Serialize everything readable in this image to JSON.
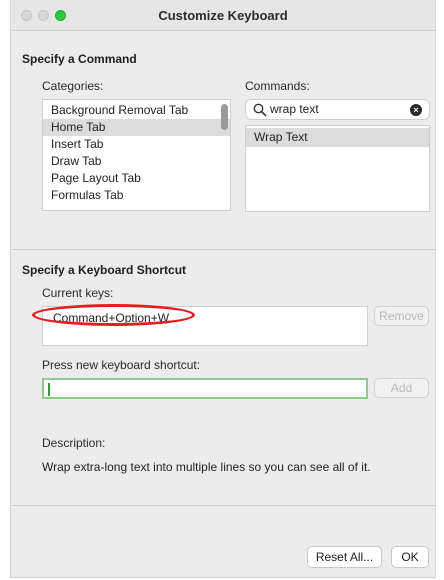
{
  "window": {
    "title": "Customize Keyboard"
  },
  "command_section": {
    "title": "Specify a Command",
    "categories_label": "Categories:",
    "categories": [
      {
        "label": "Background Removal Tab",
        "selected": false
      },
      {
        "label": "Home Tab",
        "selected": true
      },
      {
        "label": "Insert Tab",
        "selected": false
      },
      {
        "label": "Draw Tab",
        "selected": false
      },
      {
        "label": "Page Layout Tab",
        "selected": false
      },
      {
        "label": "Formulas Tab",
        "selected": false
      }
    ],
    "commands_label": "Commands:",
    "search_value": "wrap text",
    "commands": [
      {
        "label": "Wrap Text",
        "selected": true
      }
    ]
  },
  "shortcut_section": {
    "title": "Specify a Keyboard Shortcut",
    "current_keys_label": "Current keys:",
    "current_keys": [
      "Command+Option+W"
    ],
    "remove_label": "Remove",
    "new_shortcut_label": "Press new keyboard shortcut:",
    "new_shortcut_value": "",
    "add_label": "Add"
  },
  "description": {
    "label": "Description:",
    "text": "Wrap extra-long text into multiple lines so you can see all of it."
  },
  "footer": {
    "reset_label": "Reset All...",
    "ok_label": "OK"
  },
  "colors": {
    "annotation_ellipse": "#e02020",
    "focus_border": "#8ec98e",
    "zoom_button": "#2ec840"
  }
}
